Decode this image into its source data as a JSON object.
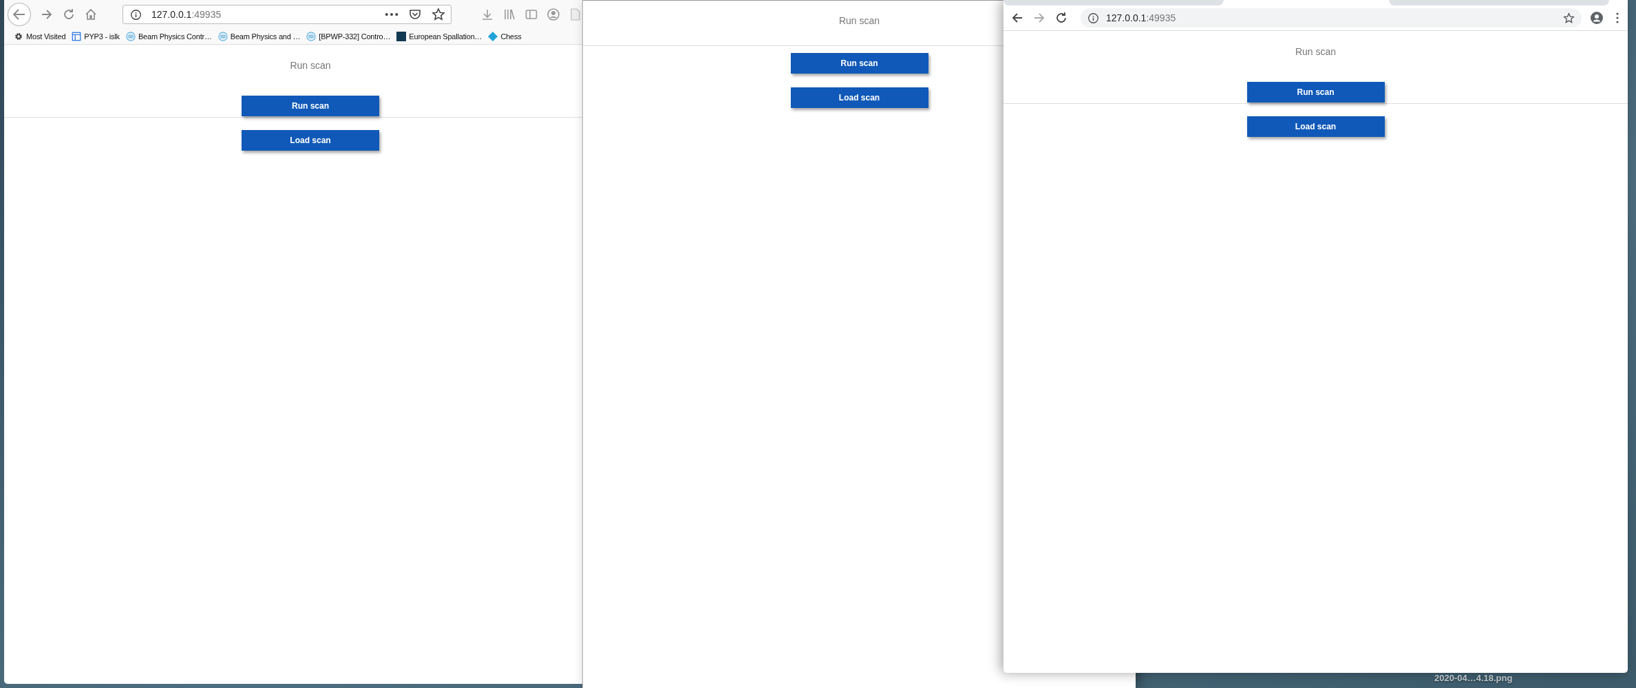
{
  "desktop": {
    "file_label": "2020-04…4.18.png"
  },
  "windows": [
    {
      "kind": "firefox",
      "url_host": "127.0.0.1",
      "url_port": ":49935",
      "bookmarks": [
        {
          "kind": "gear",
          "label": "Most Visited"
        },
        {
          "kind": "grid",
          "label": "PYP3 - islk"
        },
        {
          "kind": "ess",
          "label": "Beam Physics Contr…"
        },
        {
          "kind": "ess",
          "label": "Beam Physics and …"
        },
        {
          "kind": "ess",
          "label": "[BPWP-332] Contro…"
        },
        {
          "kind": "pos",
          "label": "European Spallation…"
        },
        {
          "kind": "diamond",
          "label": "Chess"
        }
      ],
      "page": {
        "title": "Run scan",
        "buttons": [
          "Run scan",
          "Load scan"
        ]
      }
    },
    {
      "kind": "plain",
      "page": {
        "title": "Run scan",
        "buttons": [
          "Run scan",
          "Load scan"
        ]
      }
    },
    {
      "kind": "chrome",
      "url_host": "127.0.0.1",
      "url_port": ":49935",
      "page": {
        "title": "Run scan",
        "buttons": [
          "Run scan",
          "Load scan"
        ]
      }
    }
  ]
}
